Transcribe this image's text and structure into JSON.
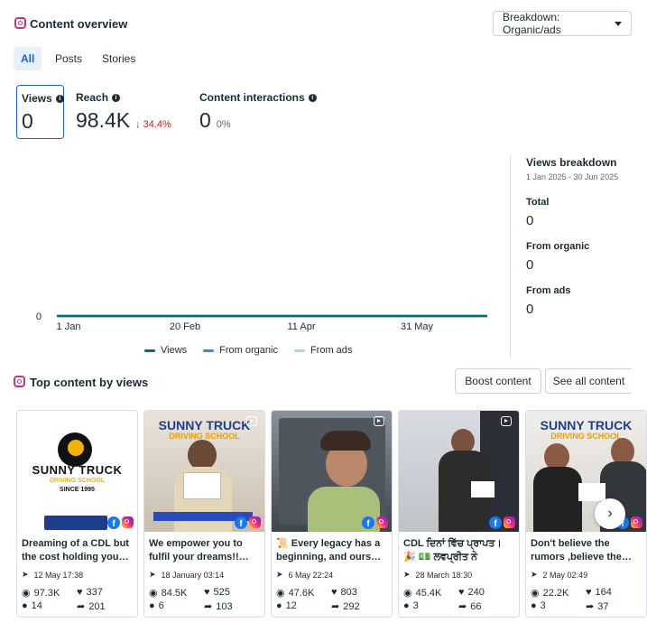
{
  "overview": {
    "title": "Content overview",
    "breakdown_label": "Breakdown: Organic/ads",
    "tabs": [
      "All",
      "Posts",
      "Stories"
    ],
    "metrics": {
      "views": {
        "label": "Views",
        "value": "0"
      },
      "reach": {
        "label": "Reach",
        "value": "98.4K",
        "change": "34.4%"
      },
      "interactions": {
        "label": "Content interactions",
        "value": "0",
        "change": "0%"
      }
    }
  },
  "chart_data": {
    "type": "line",
    "x": [
      "1 Jan",
      "20 Feb",
      "11 Apr",
      "31 May"
    ],
    "yticks": [
      "0"
    ],
    "series": [
      {
        "name": "Views",
        "values": [
          0,
          0,
          0,
          0
        ],
        "color": "#00706b"
      },
      {
        "name": "From organic",
        "values": [
          0,
          0,
          0,
          0
        ],
        "color": "#3b8ad3"
      },
      {
        "name": "From ads",
        "values": [
          0,
          0,
          0,
          0
        ],
        "color": "#a7d6ef"
      }
    ],
    "ylim": [
      0,
      0
    ],
    "legend": "bottom"
  },
  "breakdown": {
    "title": "Views breakdown",
    "range": "1 Jan 2025 - 30 Jun 2025",
    "rows": [
      {
        "label": "Total",
        "value": "0"
      },
      {
        "label": "From organic",
        "value": "0"
      },
      {
        "label": "From ads",
        "value": "0"
      }
    ]
  },
  "top": {
    "title": "Top content by views",
    "boost_label": "Boost content",
    "see_all_label": "See all content",
    "cards": [
      {
        "caption": "Dreaming of a CDL but the cost holding you…",
        "date": "12 May 17:38",
        "views": "97.3K",
        "likes": "337",
        "comments": "14",
        "shares": "201",
        "brand": "SUNNY TRUCK",
        "sub": "DRIVING SCHOOL",
        "since": "SINCE 1995"
      },
      {
        "caption": "We empower you to fulfil your dreams!!…",
        "date": "18 January 03:14",
        "views": "84.5K",
        "likes": "525",
        "comments": "6",
        "shares": "103",
        "brand": "SUNNY TRUCK",
        "sub": "DRIVING SCHOOL"
      },
      {
        "caption": "📜 Every legacy has a beginning, and ours…",
        "date": "6 May 22:24",
        "views": "47.6K",
        "likes": "803",
        "comments": "12",
        "shares": "292"
      },
      {
        "caption": "CDL ਦਿਨਾਂ ਵਿੱਚ ਪ੍ਰਾਪਤ। 🎉 💵 ਲਵਪ੍ਰੀਤ ਨੇ ਆਪਨਾ…",
        "date": "28 March 18:30",
        "views": "45.4K",
        "likes": "240",
        "comments": "3",
        "shares": "66"
      },
      {
        "caption": "Don't believe the rumors ,believe the…",
        "date": "2 May 02:49",
        "views": "22.2K",
        "likes": "164",
        "comments": "3",
        "shares": "37",
        "brand": "SUNNY TRUCK",
        "sub": "DRIVING SCHOOL"
      }
    ]
  },
  "colors": {
    "accent": "#1b63c6",
    "decline": "#b3261e",
    "views_line": "#00706b"
  }
}
